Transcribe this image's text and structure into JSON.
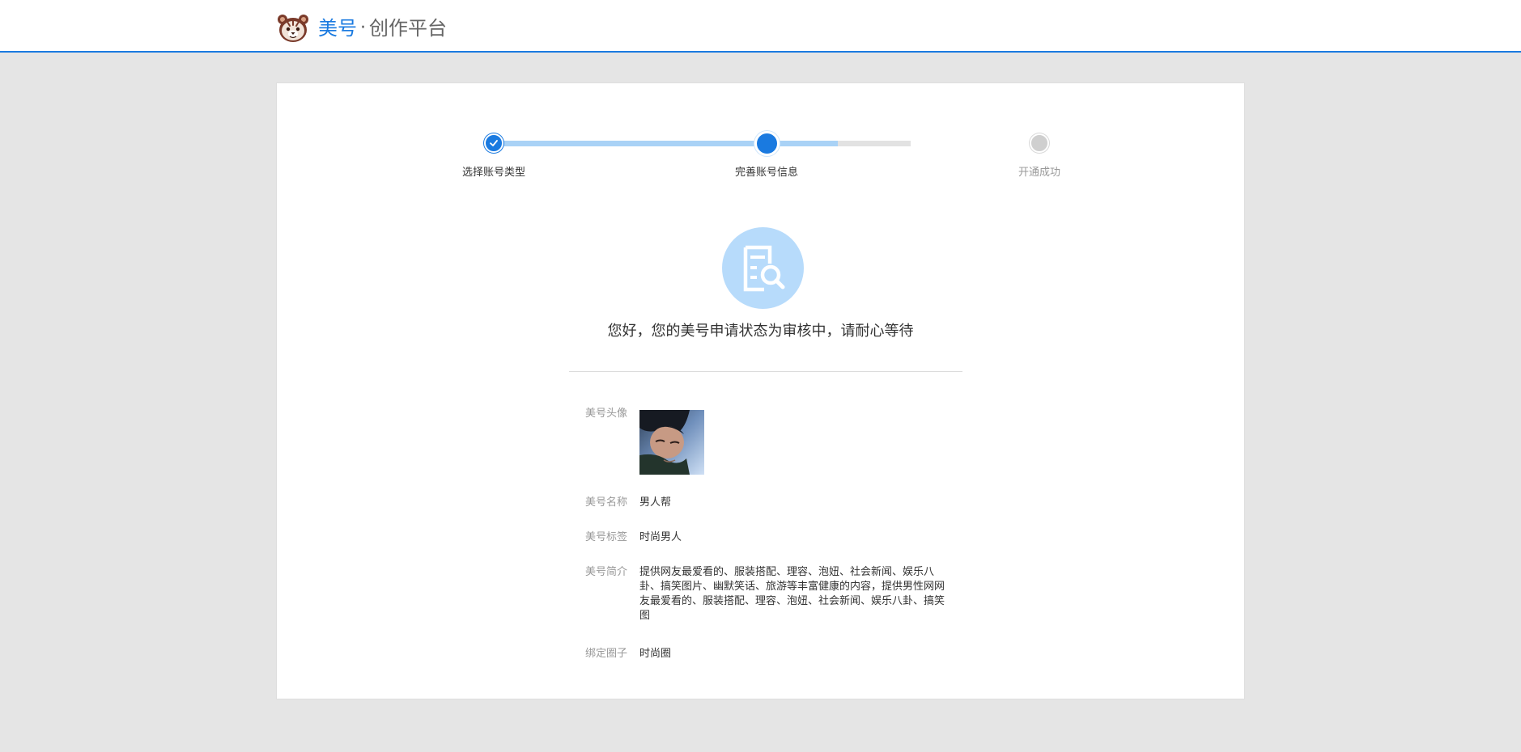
{
  "header": {
    "brand_name": "美号",
    "brand_separator": "·",
    "brand_subtitle": "创作平台",
    "logo_icon": "tiger-logo-icon"
  },
  "stepper": {
    "steps": [
      {
        "label": "选择账号类型",
        "state": "done"
      },
      {
        "label": "完善账号信息",
        "state": "current"
      },
      {
        "label": "开通成功",
        "state": "pending"
      }
    ]
  },
  "status": {
    "icon": "document-search-icon",
    "message": "您好，您的美号申请状态为审核中，请耐心等待"
  },
  "info": {
    "avatar_label": "美号头像",
    "name_label": "美号名称",
    "name_value": "男人帮",
    "tag_label": "美号标签",
    "tag_value": "时尚男人",
    "desc_label": "美号简介",
    "desc_value": "提供网友最爱看的、服装搭配、理容、泡妞、社会新闻、娱乐八卦、搞笑图片、幽默笑话、旅游等丰富健康的内容，提供男性网网友最爱看的、服装搭配、理容、泡妞、社会新闻、娱乐八卦、搞笑图",
    "circle_label": "绑定圈子",
    "circle_value": "时尚圈"
  },
  "colors": {
    "accent": "#1a7ae0",
    "accent_light": "#a9d2f6",
    "status_circle": "#b7dbfb",
    "background": "#e5e5e5"
  }
}
